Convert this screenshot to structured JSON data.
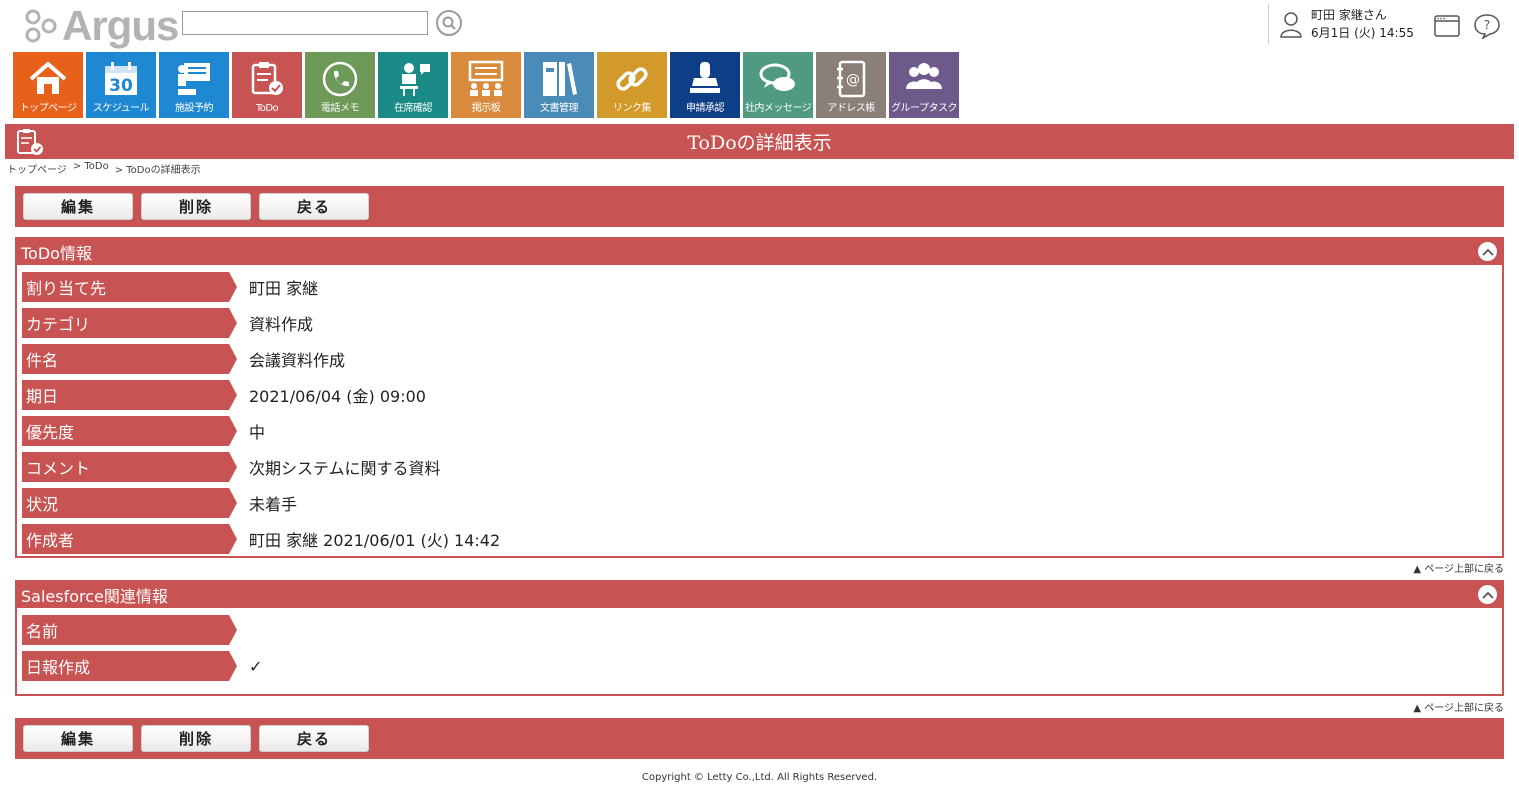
{
  "header": {
    "logo_text": "Argus",
    "search_placeholder": "",
    "user_name": "町田 家継さん",
    "datetime": "6月1日 (火) 14:55"
  },
  "nav": [
    {
      "label": "トップページ",
      "icon": "home-icon",
      "color": "#e8611a"
    },
    {
      "label": "スケジュール",
      "icon": "calendar-icon",
      "color": "#1e88d2",
      "num": "30"
    },
    {
      "label": "施設予約",
      "icon": "facility-icon",
      "color": "#1e88d2"
    },
    {
      "label": "ToDo",
      "icon": "todo-icon",
      "color": "#c85353"
    },
    {
      "label": "電話メモ",
      "icon": "phone-icon",
      "color": "#6d9a58"
    },
    {
      "label": "在席確認",
      "icon": "attendance-icon",
      "color": "#1a8a86"
    },
    {
      "label": "掲示板",
      "icon": "board-icon",
      "color": "#d98a3c"
    },
    {
      "label": "文書管理",
      "icon": "documents-icon",
      "color": "#4a8bb8"
    },
    {
      "label": "リンク集",
      "icon": "link-icon",
      "color": "#d19a2a"
    },
    {
      "label": "申請承認",
      "icon": "stamp-icon",
      "color": "#0e3f86"
    },
    {
      "label": "社内メッセージ",
      "icon": "message-icon",
      "color": "#4f9a80"
    },
    {
      "label": "アドレス帳",
      "icon": "address-book-icon",
      "color": "#8a7f79"
    },
    {
      "label": "グループタスク",
      "icon": "group-icon",
      "color": "#6d5a8a"
    }
  ],
  "page": {
    "title": "ToDoの詳細表示",
    "breadcrumb": [
      "トップページ",
      "> ToDo",
      "> ToDoの詳細表示"
    ]
  },
  "buttons": {
    "edit": "編集",
    "delete": "削除",
    "back": "戻る"
  },
  "todo_panel": {
    "title": "ToDo情報",
    "rows": [
      {
        "label": "割り当て先",
        "value": "町田 家継"
      },
      {
        "label": "カテゴリ",
        "value": "資料作成"
      },
      {
        "label": "件名",
        "value": "会議資料作成"
      },
      {
        "label": "期日",
        "value": "2021/06/04 (金) 09:00"
      },
      {
        "label": "優先度",
        "value": "中"
      },
      {
        "label": "コメント",
        "value": "次期システムに関する資料"
      },
      {
        "label": "状況",
        "value": "未着手"
      },
      {
        "label": "作成者",
        "value": "町田 家継 2021/06/01 (火) 14:42"
      }
    ]
  },
  "salesforce_panel": {
    "title": "Salesforce関連情報",
    "rows": [
      {
        "label": "名前",
        "value": ""
      },
      {
        "label": "日報作成",
        "value": "✓"
      }
    ]
  },
  "to_top": "▲ ページ上部に戻る",
  "footer": "Copyright © Letty Co.,Ltd. All Rights Reserved.",
  "colors": {
    "accent": "#c85353"
  }
}
